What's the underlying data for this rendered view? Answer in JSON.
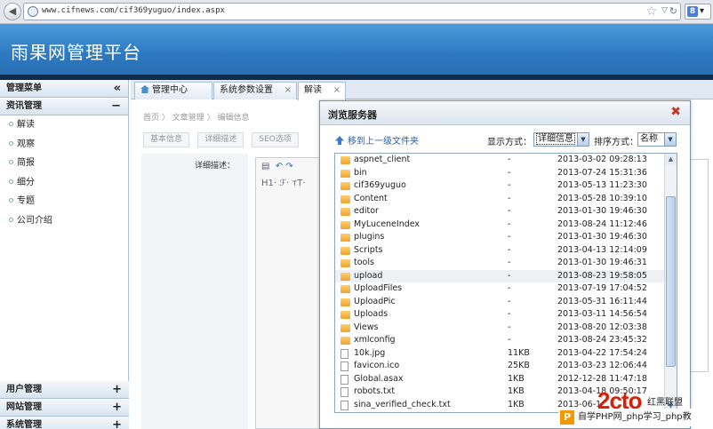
{
  "browser": {
    "url": "www.cifnews.com/cif369yuguo/index.aspx",
    "search_engine_icon": "google-icon"
  },
  "header": {
    "title": "雨果网管理平台"
  },
  "sidebar": {
    "menu_title": "管理菜单",
    "collapse_glyph": "«",
    "section": {
      "label": "资讯管理",
      "toggle": "−"
    },
    "items": [
      {
        "label": "解读"
      },
      {
        "label": "观察"
      },
      {
        "label": "简报"
      },
      {
        "label": "细分"
      },
      {
        "label": "专题"
      },
      {
        "label": "公司介绍"
      }
    ],
    "bottom": [
      {
        "label": "用户管理",
        "toggle": "+"
      },
      {
        "label": "网站管理",
        "toggle": "+"
      },
      {
        "label": "系统管理",
        "toggle": "+"
      }
    ]
  },
  "tabs": [
    {
      "label": "管理中心"
    },
    {
      "label": "系统参数设置",
      "close": "×"
    },
    {
      "label": "解读",
      "close": "×"
    }
  ],
  "content": {
    "breadcrumb": "首页 〉 文章管理 〉 编辑信息",
    "subtabs": [
      "基本信息",
      "详细描述",
      "SEO选项"
    ],
    "detail_label": "详细描述：",
    "editor_row2": "H1·  ℱ·  ᴛT·"
  },
  "dialog": {
    "title": "浏览服务器",
    "close": "✖",
    "up_label": "移到上一级文件夹",
    "view_label": "显示方式：",
    "view_value": "详细信息",
    "sort_label": "排序方式：",
    "sort_value": "名称",
    "files": [
      {
        "name": "aspnet_client",
        "size": "-",
        "date": "2013-03-02 09:28:13",
        "type": "folder"
      },
      {
        "name": "bin",
        "size": "-",
        "date": "2013-07-24 15:31:36",
        "type": "folder"
      },
      {
        "name": "cif369yuguo",
        "size": "-",
        "date": "2013-05-13 11:23:30",
        "type": "folder"
      },
      {
        "name": "Content",
        "size": "-",
        "date": "2013-05-28 10:39:10",
        "type": "folder"
      },
      {
        "name": "editor",
        "size": "-",
        "date": "2013-01-30 19:46:30",
        "type": "folder"
      },
      {
        "name": "MyLuceneIndex",
        "size": "-",
        "date": "2013-08-24 11:12:46",
        "type": "folder"
      },
      {
        "name": "plugins",
        "size": "-",
        "date": "2013-01-30 19:46:30",
        "type": "folder"
      },
      {
        "name": "Scripts",
        "size": "-",
        "date": "2013-04-13 12:14:09",
        "type": "folder"
      },
      {
        "name": "tools",
        "size": "-",
        "date": "2013-01-30 19:46:31",
        "type": "folder"
      },
      {
        "name": "upload",
        "size": "-",
        "date": "2013-08-23 19:58:05",
        "type": "folder",
        "selected": true
      },
      {
        "name": "UploadFiles",
        "size": "-",
        "date": "2013-07-19 17:04:52",
        "type": "folder"
      },
      {
        "name": "UploadPic",
        "size": "-",
        "date": "2013-05-31 16:11:44",
        "type": "folder"
      },
      {
        "name": "Uploads",
        "size": "-",
        "date": "2013-03-11 14:56:54",
        "type": "folder"
      },
      {
        "name": "Views",
        "size": "-",
        "date": "2013-08-20 12:03:38",
        "type": "folder"
      },
      {
        "name": "xmlconfig",
        "size": "-",
        "date": "2013-08-24 23:45:32",
        "type": "folder"
      },
      {
        "name": "10k.jpg",
        "size": "11KB",
        "date": "2013-04-22 17:54:24",
        "type": "file"
      },
      {
        "name": "favicon.ico",
        "size": "25KB",
        "date": "2013-03-23 12:06:44",
        "type": "file"
      },
      {
        "name": "Global.asax",
        "size": "1KB",
        "date": "2012-12-28 11:47:18",
        "type": "file"
      },
      {
        "name": "robots.txt",
        "size": "1KB",
        "date": "2013-04-18 09:50:17",
        "type": "file"
      },
      {
        "name": "sina_verified_check.txt",
        "size": "1KB",
        "date": "2013-06-1",
        "type": "file"
      }
    ]
  },
  "watermark": {
    "logo": "2cto",
    "union": "红黑联盟",
    "bar": "自学PHP网_php学习_php教"
  }
}
